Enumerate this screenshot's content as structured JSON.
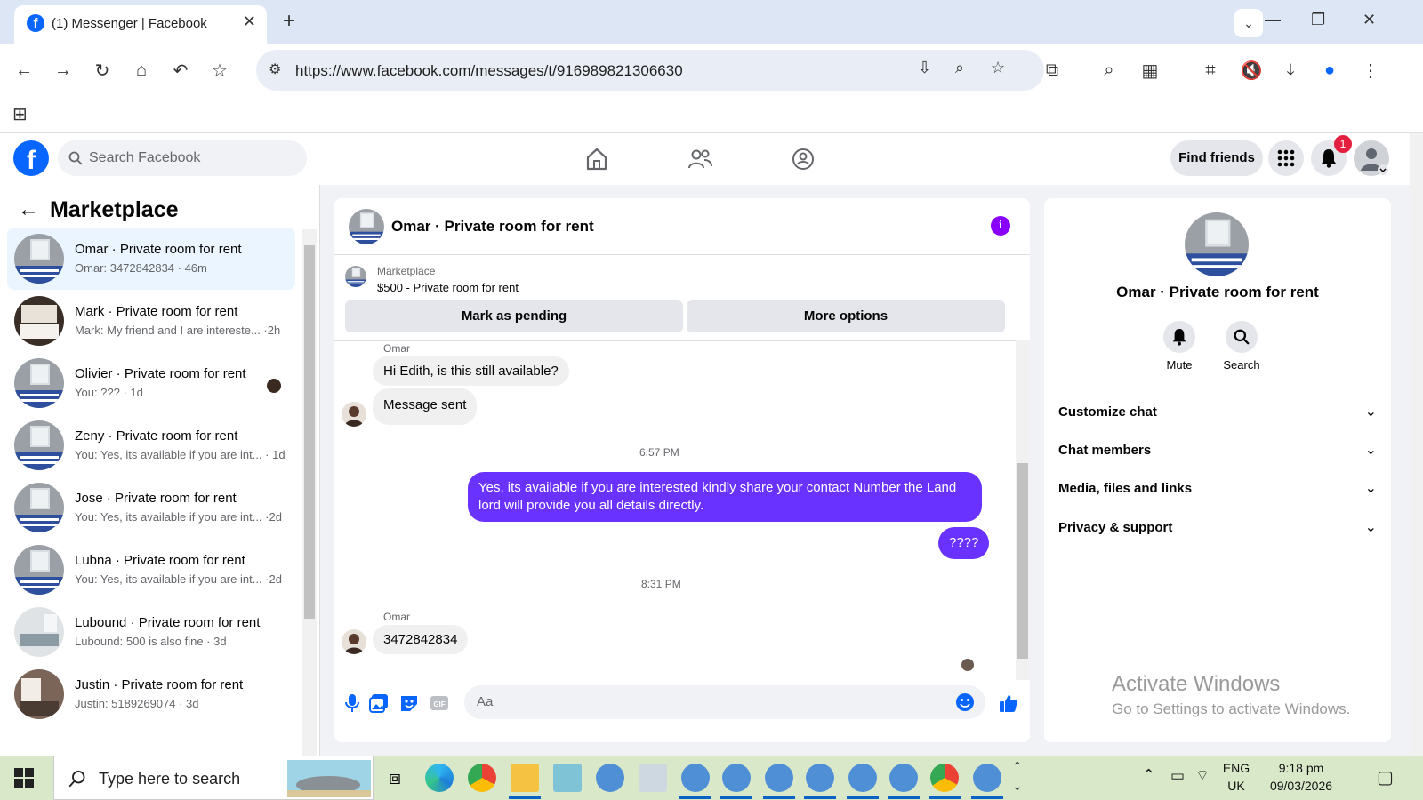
{
  "browser": {
    "tab_title": "(1) Messenger | Facebook",
    "url": "https://www.facebook.com/messages/t/916989821306630"
  },
  "fb_header": {
    "search_placeholder": "Search Facebook",
    "find_friends": "Find friends",
    "notification_count": "1"
  },
  "sidebar": {
    "title": "Marketplace",
    "conversations": [
      {
        "name": "Omar · Private room for rent",
        "preview": "Omar: 3472842834 · 46m",
        "active": true
      },
      {
        "name": "Mark · Private room for rent",
        "preview": "Mark: My friend and I are intereste... ·2h",
        "active": false
      },
      {
        "name": "Olivier · Private room for rent",
        "preview": "You: ??? · 1d",
        "active": false
      },
      {
        "name": "Zeny · Private room for rent",
        "preview": "You: Yes, its available if you are int... · 1d",
        "active": false
      },
      {
        "name": "Jose · Private room for rent",
        "preview": "You: Yes, its available if you are int... ·2d",
        "active": false
      },
      {
        "name": "Lubna · Private room for rent",
        "preview": "You: Yes, its available if you are int... ·2d",
        "active": false
      },
      {
        "name": "Lubound · Private room for rent",
        "preview": "Lubound: 500 is also fine · 3d",
        "active": false
      },
      {
        "name": "Justin · Private room for rent",
        "preview": "Justin: 5189269074 · 3d",
        "active": false
      }
    ]
  },
  "chat": {
    "title": "Omar · Private room for rent",
    "marketplace_label": "Marketplace",
    "listing": "$500 - Private room for rent",
    "mark_pending": "Mark as pending",
    "more_options": "More options",
    "sender_name": "Omar",
    "msg1": "Hi Edith, is this still available?",
    "msg2": "Message sent",
    "time1": "6:57 PM",
    "out1": "Yes, its available if you are interested kindly share your contact Number the Land lord will provide you all details directly.",
    "out2": "????",
    "time2": "8:31 PM",
    "sender_name2": "Omar",
    "msg3": "3472842834",
    "composer_placeholder": "Aa"
  },
  "right_panel": {
    "name": "Omar · Private room for rent",
    "mute": "Mute",
    "search": "Search",
    "rows": [
      "Customize chat",
      "Chat members",
      "Media, files and links",
      "Privacy & support"
    ]
  },
  "watermark": {
    "line1": "Activate Windows",
    "line2": "Go to Settings to activate Windows."
  },
  "taskbar": {
    "search_placeholder": "Type here to search",
    "lang1": "ENG",
    "lang2": "UK",
    "time": "9:18 pm",
    "date": "09/03/2026"
  },
  "colors": {
    "fb_blue": "#0866ff",
    "outgoing_bubble": "#6a32ff",
    "info_purple": "#8a00ff"
  }
}
